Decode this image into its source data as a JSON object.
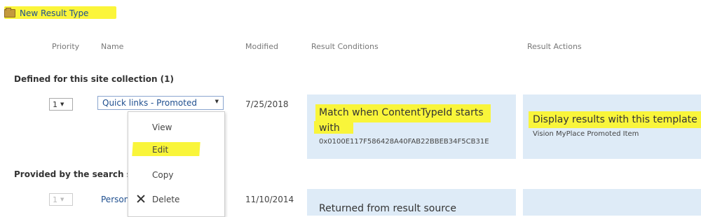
{
  "top": {
    "new_label": "New Result Type"
  },
  "columns": {
    "priority": "Priority",
    "name": "Name",
    "modified": "Modified",
    "conditions": "Result Conditions",
    "actions": "Result Actions"
  },
  "sections": {
    "site_collection": "Defined for this site collection (1)",
    "search_service": "Provided by the search se"
  },
  "row1": {
    "priority": "1",
    "name": "Quick links - Promoted",
    "modified": "7/25/2018",
    "condition_line1": "Match when ContentTypeId starts",
    "condition_line2": "with",
    "condition_value": "0x0100E117F586428A40FAB22BBEB34F5CB31E",
    "action_title": "Display results with this template",
    "action_value": "Vision MyPlace Promoted Item"
  },
  "row2": {
    "priority": "1",
    "name": "Person",
    "modified": "11/10/2014",
    "condition_text": "Returned from result source"
  },
  "menu": {
    "items": [
      "View",
      "Edit",
      "Copy",
      "Delete"
    ]
  },
  "colors": {
    "highlight": "#f9f53a",
    "link": "#1f4f8f",
    "panel": "#deebf7"
  }
}
